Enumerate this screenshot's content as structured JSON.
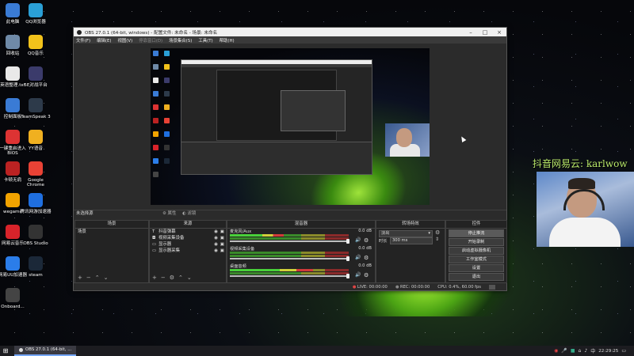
{
  "desktop": {
    "icons": [
      {
        "label": "此电脑",
        "icon": "computer-icon",
        "color": "#3a7bd5"
      },
      {
        "label": "QQ浏览器",
        "icon": "qq-browser-icon",
        "color": "#2a9fd6"
      },
      {
        "label": "回收站",
        "icon": "recycle-bin-icon",
        "color": "#6f8aa8"
      },
      {
        "label": "QQ音乐",
        "icon": "qq-music-icon",
        "color": "#f2c21b"
      },
      {
        "label": "英语整理.txt",
        "icon": "text-file-icon",
        "color": "#e9e9e9"
      },
      {
        "label": "5E对战平台",
        "icon": "5e-icon",
        "color": "#3b3b6b"
      },
      {
        "label": "控制面板",
        "icon": "control-panel-icon",
        "color": "#3a7bd5"
      },
      {
        "label": "TeamSpeak 3",
        "icon": "teamspeak-icon",
        "color": "#2d3a4a"
      },
      {
        "label": "一键重启进入BIOS",
        "icon": "power-icon",
        "color": "#d33"
      },
      {
        "label": "YY语音",
        "icon": "yy-icon",
        "color": "#f0b020"
      },
      {
        "label": "卡顿无肩",
        "icon": "game-icon",
        "color": "#b22"
      },
      {
        "label": "Google Chrome",
        "icon": "chrome-icon",
        "color": "#e94235"
      },
      {
        "label": "wegame",
        "icon": "wegame-icon",
        "color": "#f2a300"
      },
      {
        "label": "腾讯网游加速器",
        "icon": "accelerator-icon",
        "color": "#1f6fe0"
      },
      {
        "label": "网易云音乐",
        "icon": "netease-music-icon",
        "color": "#d8232a"
      },
      {
        "label": "OBS Studio",
        "icon": "obs-icon",
        "color": "#333"
      },
      {
        "label": "网易UU加速器",
        "icon": "uu-icon",
        "color": "#2b7de9"
      },
      {
        "label": "steam",
        "icon": "steam-icon",
        "color": "#1b2838"
      },
      {
        "label": "Onboard...",
        "icon": "onboard-icon",
        "color": "#444"
      }
    ]
  },
  "obs": {
    "title": "OBS 27.0.1 (64-bit, windows) - 配置文件: 未命名 - 场景: 未命名",
    "menu": [
      "文件(F)",
      "编辑(E)",
      "视图(V)",
      "停靠窗口(D)",
      "场景集合(S)",
      "工具(T)",
      "帮助(H)"
    ],
    "menu_disabled_index": 3,
    "no_source_selected": "未选择源",
    "props_label": "属性",
    "filters_label": "滤镜",
    "docks": {
      "scenes": "场景",
      "sources": "来源",
      "mixer": "混音器",
      "transitions": "转场特效",
      "controls": "控件"
    },
    "scenes": [
      "场景"
    ],
    "sources": [
      "抖音弹幕",
      "视频采集设备",
      "显示器",
      "显示器采集"
    ],
    "mixer": [
      {
        "name": "麦克风/Aux",
        "db": "0.0 dB",
        "level": 0.45
      },
      {
        "name": "视频采集设备",
        "db": "0.0 dB",
        "level": 0.0
      },
      {
        "name": "桌面音频",
        "db": "0.0 dB",
        "level": 0.7
      }
    ],
    "transition": {
      "type": "淡出",
      "duration_label": "时长",
      "duration": "300 ms"
    },
    "controls": [
      "停止推流",
      "开始录制",
      "启动虚拟摄像机",
      "工作室模式",
      "设置",
      "退出"
    ],
    "status": {
      "live": "LIVE: 00:00:00",
      "rec": "REC: 00:00:00",
      "cpu": "CPU: 0.4%, 60.00 fps"
    }
  },
  "overlay": {
    "text": "抖音网易云: karlwow"
  },
  "taskbar": {
    "item": "OBS 27.0.1 (64-bit, ...",
    "time": "22:29:25"
  }
}
